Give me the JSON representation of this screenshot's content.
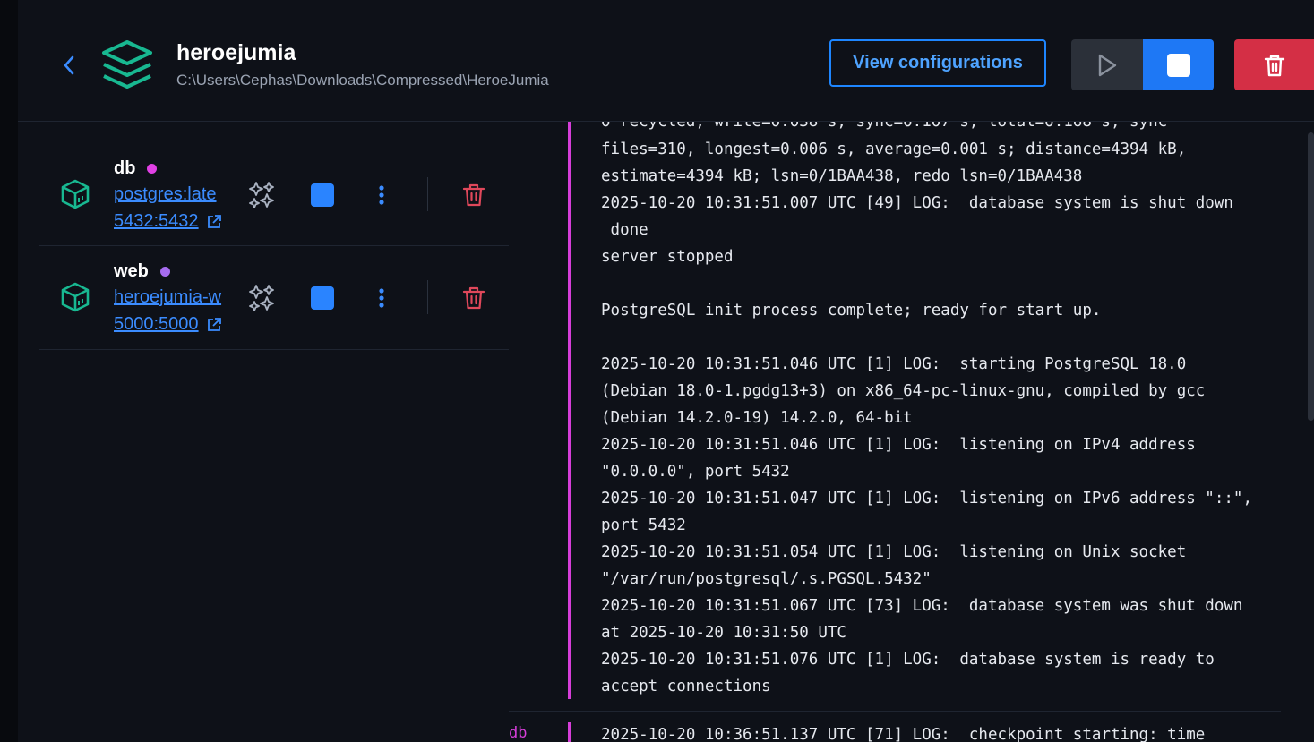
{
  "header": {
    "title": "heroejumia",
    "path": "C:\\Users\\Cephas\\Downloads\\Compressed\\HeroeJumia",
    "view_configurations_label": "View configurations",
    "accent_color": "#1e86ff",
    "danger_color": "#d42f45"
  },
  "services": [
    {
      "name": "db",
      "status_color": "#e040e4",
      "image": "postgres:late",
      "port": "5432:5432"
    },
    {
      "name": "web",
      "status_color": "#a66cf0",
      "image": "heroejumia-w",
      "port": "5000:5000"
    }
  ],
  "logs": {
    "top_partial_line": "0 recycled; write=0.038 s, sync=0.107 s, total=0.168 s; sync",
    "lines": [
      "files=310, longest=0.006 s, average=0.001 s; distance=4394 kB,",
      "estimate=4394 kB; lsn=0/1BAA438, redo lsn=0/1BAA438",
      "2025-10-20 10:31:51.007 UTC [49] LOG:  database system is shut down",
      " done",
      "server stopped",
      "",
      "PostgreSQL init process complete; ready for start up.",
      "",
      "2025-10-20 10:31:51.046 UTC [1] LOG:  starting PostgreSQL 18.0",
      "(Debian 18.0-1.pgdg13+3) on x86_64-pc-linux-gnu, compiled by gcc",
      "(Debian 14.2.0-19) 14.2.0, 64-bit",
      "2025-10-20 10:31:51.046 UTC [1] LOG:  listening on IPv4 address",
      "\"0.0.0.0\", port 5432",
      "2025-10-20 10:31:51.047 UTC [1] LOG:  listening on IPv6 address \"::\",",
      "port 5432",
      "2025-10-20 10:31:51.054 UTC [1] LOG:  listening on Unix socket",
      "\"/var/run/postgresql/.s.PGSQL.5432\"",
      "2025-10-20 10:31:51.067 UTC [73] LOG:  database system was shut down",
      "at 2025-10-20 10:31:50 UTC",
      "2025-10-20 10:31:51.076 UTC [1] LOG:  database system is ready to",
      "accept connections"
    ],
    "next_entry_service": "db",
    "next_entry_text": "2025-10-20 10:36:51.137 UTC [71] LOG:  checkpoint starting: time",
    "service_color": "#d63ed9"
  }
}
